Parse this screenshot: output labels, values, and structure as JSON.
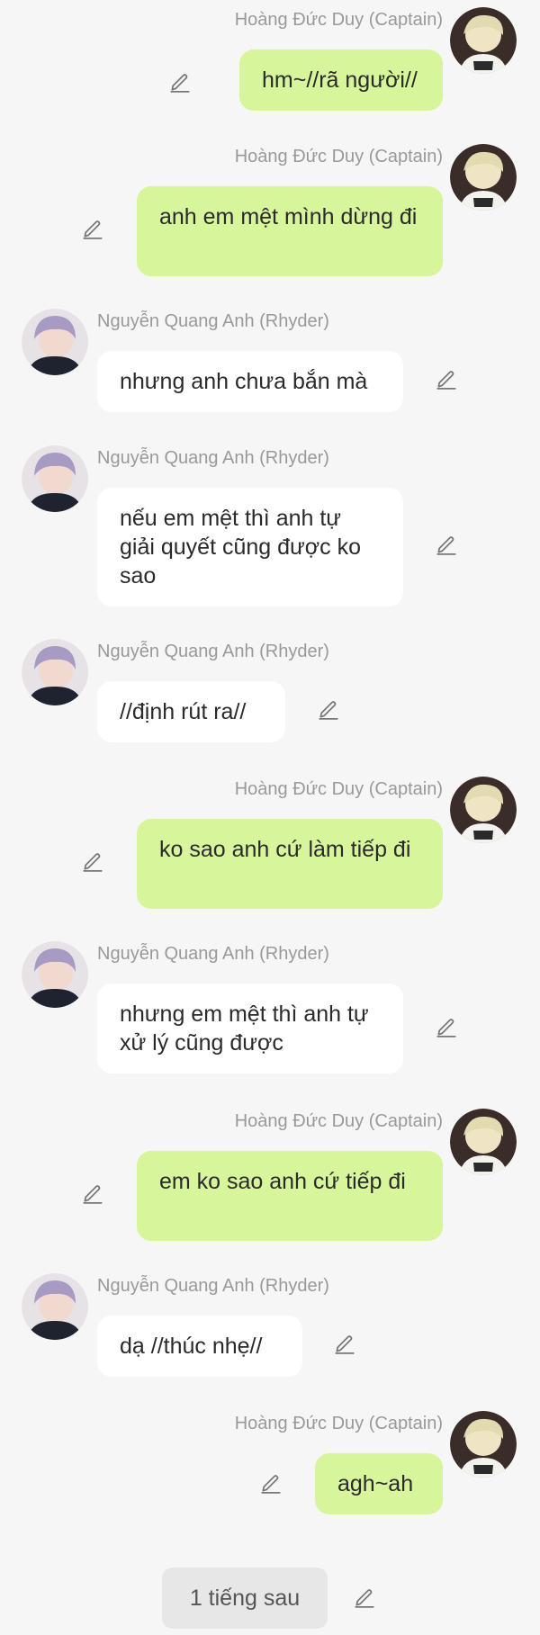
{
  "participants": {
    "captain": "Hoàng Đức Duy (Captain)",
    "rhyder": "Nguyễn Quang Anh (Rhyder)"
  },
  "messages": [
    {
      "sender": "captain",
      "text": "hm~//rã người//"
    },
    {
      "sender": "captain",
      "text": "anh em mệt mình dừng đi"
    },
    {
      "sender": "rhyder",
      "text": "nhưng anh chưa bắn mà"
    },
    {
      "sender": "rhyder",
      "text": "nếu em mệt thì anh tự giải quyết cũng được ko sao"
    },
    {
      "sender": "rhyder",
      "text": "//định rút ra//"
    },
    {
      "sender": "captain",
      "text": "ko sao anh cứ làm tiếp đi"
    },
    {
      "sender": "rhyder",
      "text": "nhưng em mệt thì anh tự xử lý cũng được"
    },
    {
      "sender": "captain",
      "text": "em ko sao anh cứ tiếp đi"
    },
    {
      "sender": "rhyder",
      "text": "dạ //thúc nhẹ//"
    },
    {
      "sender": "captain",
      "text": "agh~ah"
    }
  ],
  "footer": {
    "time_label": "1 tiếng sau"
  },
  "colors": {
    "background": "#f6f6f6",
    "captain_bubble": "#d7f59b",
    "rhyder_bubble": "#ffffff",
    "name_text": "#999999"
  },
  "icons": {
    "edit": "pencil-icon",
    "avatar_captain": "avatar-captain-photo",
    "avatar_rhyder": "avatar-rhyder-photo"
  }
}
